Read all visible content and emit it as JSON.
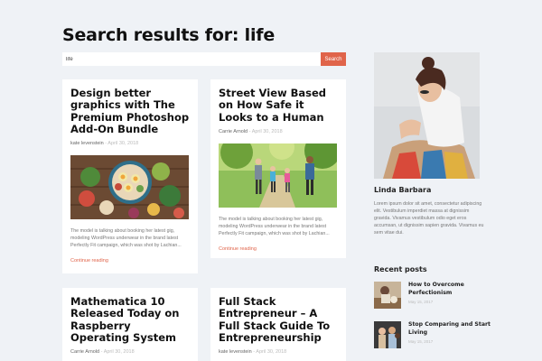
{
  "page": {
    "title": "Search results for: life"
  },
  "search": {
    "value": "life",
    "button_label": "Search"
  },
  "posts": [
    {
      "title": "Design better graphics with The Premium Photoshop Add-On Bundle",
      "author": "kate levenstein",
      "separator": " - ",
      "date": "April 30, 2018",
      "excerpt": "The model is talking about booking her latest gig, modeling WordPress underwear in the brand latest Perfectly Fit campaign, which was shot by Lachian...",
      "link": "Continue reading"
    },
    {
      "title": "Street View Based on How Safe it Looks to a Human",
      "author": "Carrie Arnold",
      "separator": " - ",
      "date": "April 30, 2018",
      "excerpt": "The model is talking about booking her latest gig, modeling WordPress underwear in the brand latest Perfectly Fit campaign, which was shot by Lachian...",
      "link": "Continue reading"
    },
    {
      "title": "Mathematica 10 Released Today on Raspberry Operating System",
      "author": "Carrie Arnold",
      "separator": " - ",
      "date": "April 30, 2018"
    },
    {
      "title": "Full Stack Entrepreneur – A Full Stack Guide To Entrepreneurship",
      "author": "kate levenstein",
      "separator": " - ",
      "date": "April 30, 2018"
    }
  ],
  "sidebar": {
    "author_name": "Linda Barbara",
    "author_bio": "Lorem ipsum dolor sit amet, consectetur adipiscing elit. Vestibulum imperdiet massa at dignissim gravida. Vivamus vestibulum odio eget eros accumsan, ut dignissim sapien gravida. Vivamus eu sem vitae dui.",
    "recent_posts_title": "Recent posts",
    "recent_posts": [
      {
        "title": "How to Overcome Perfectionism",
        "date": "May 15, 2017"
      },
      {
        "title": "Stop Comparing and Start Living",
        "date": "May 15, 2017"
      }
    ]
  },
  "colors": {
    "accent": "#e0644a",
    "background": "#eff2f6",
    "card": "#ffffff"
  }
}
